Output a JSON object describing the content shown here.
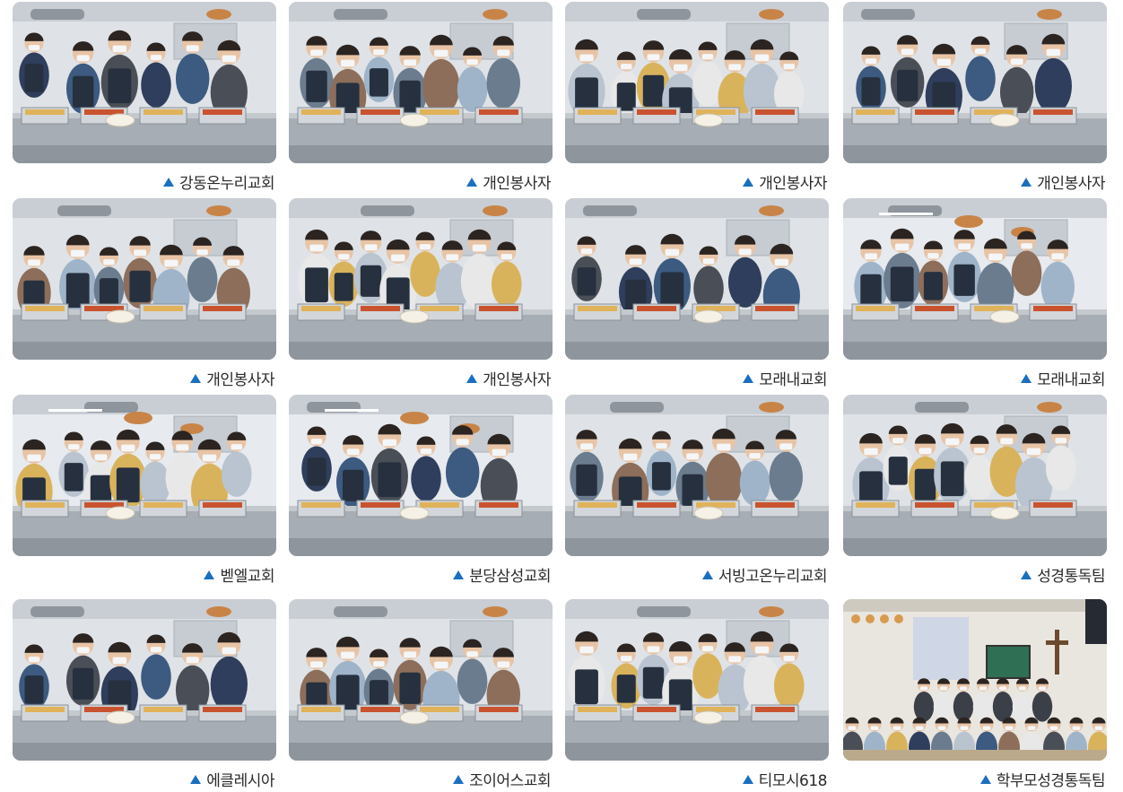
{
  "colors": {
    "marker": "#1b6fbf"
  },
  "photos": [
    {
      "caption": "강동온누리교회",
      "scene": "kitchen",
      "icon": "triangle-marker-icon"
    },
    {
      "caption": "개인봉사자",
      "scene": "kitchen",
      "icon": "triangle-marker-icon"
    },
    {
      "caption": "개인봉사자",
      "scene": "kitchen",
      "icon": "triangle-marker-icon"
    },
    {
      "caption": "개인봉사자",
      "scene": "kitchen",
      "icon": "triangle-marker-icon"
    },
    {
      "caption": "개인봉사자",
      "scene": "kitchen",
      "icon": "triangle-marker-icon"
    },
    {
      "caption": "개인봉사자",
      "scene": "kitchen",
      "icon": "triangle-marker-icon"
    },
    {
      "caption": "모래내교회",
      "scene": "kitchen",
      "icon": "triangle-marker-icon"
    },
    {
      "caption": "모래내교회",
      "scene": "hall",
      "icon": "triangle-marker-icon"
    },
    {
      "caption": "벧엘교회",
      "scene": "hall",
      "icon": "triangle-marker-icon"
    },
    {
      "caption": "분당삼성교회",
      "scene": "hall",
      "icon": "triangle-marker-icon"
    },
    {
      "caption": "서빙고온누리교회",
      "scene": "kitchen",
      "icon": "triangle-marker-icon"
    },
    {
      "caption": "성경통독팀",
      "scene": "kitchen",
      "icon": "triangle-marker-icon"
    },
    {
      "caption": "에클레시아",
      "scene": "kitchen",
      "icon": "triangle-marker-icon"
    },
    {
      "caption": "조이어스교회",
      "scene": "kitchen",
      "icon": "triangle-marker-icon"
    },
    {
      "caption": "티모시618",
      "scene": "kitchen",
      "icon": "triangle-marker-icon"
    },
    {
      "caption": "학부모성경통독팀",
      "scene": "chapel",
      "icon": "triangle-marker-icon"
    }
  ]
}
